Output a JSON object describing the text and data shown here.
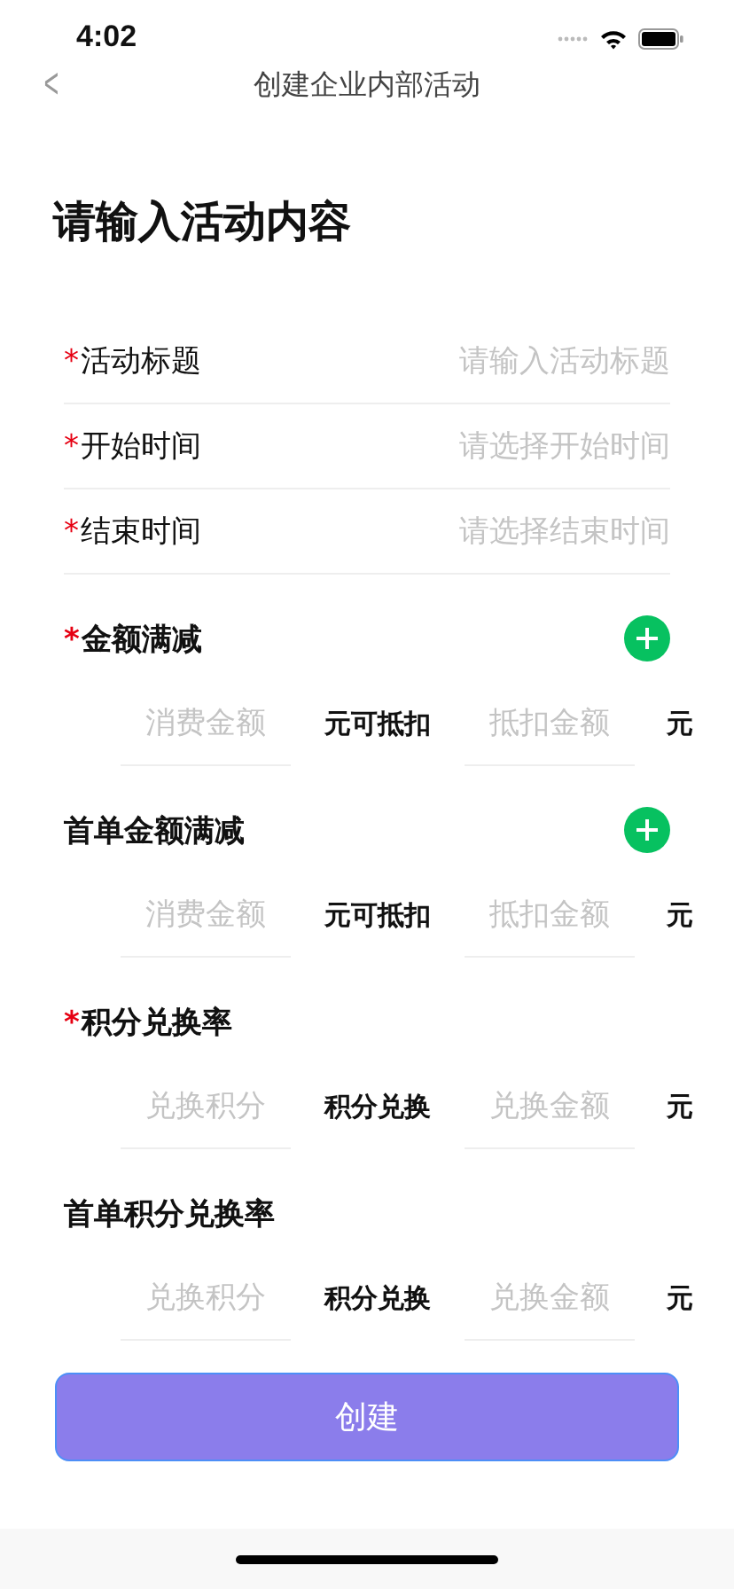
{
  "status_bar": {
    "time": "4:02"
  },
  "nav": {
    "back": "<",
    "title": "创建企业内部活动"
  },
  "heading": "请输入活动内容",
  "fields": [
    {
      "mark": "*",
      "label": "活动标题",
      "placeholder": "请输入活动标题"
    },
    {
      "mark": "*",
      "label": "开始时间",
      "placeholder": "请选择开始时间"
    },
    {
      "mark": "*",
      "label": "结束时间",
      "placeholder": "请选择结束时间"
    }
  ],
  "sections": [
    {
      "mark": "*",
      "title": "金额满减",
      "add_button": true,
      "first_placeholder": "消费金额",
      "middle": "元可抵扣",
      "second_placeholder": "抵扣金额",
      "unit": "元"
    },
    {
      "title": "首单金额满减",
      "add_button": true,
      "first_placeholder": "消费金额",
      "middle": "元可抵扣",
      "second_placeholder": "抵扣金额",
      "unit": "元"
    },
    {
      "mark": "*",
      "title": "积分兑换率",
      "add_button": false,
      "first_placeholder": "兑换积分",
      "middle": "积分兑换",
      "second_placeholder": "兑换金额",
      "unit": "元"
    },
    {
      "title": "首单积分兑换率",
      "add_button": false,
      "first_placeholder": "兑换积分",
      "middle": "积分兑换",
      "second_placeholder": "兑换金额",
      "unit": "元"
    }
  ],
  "button": "创建"
}
